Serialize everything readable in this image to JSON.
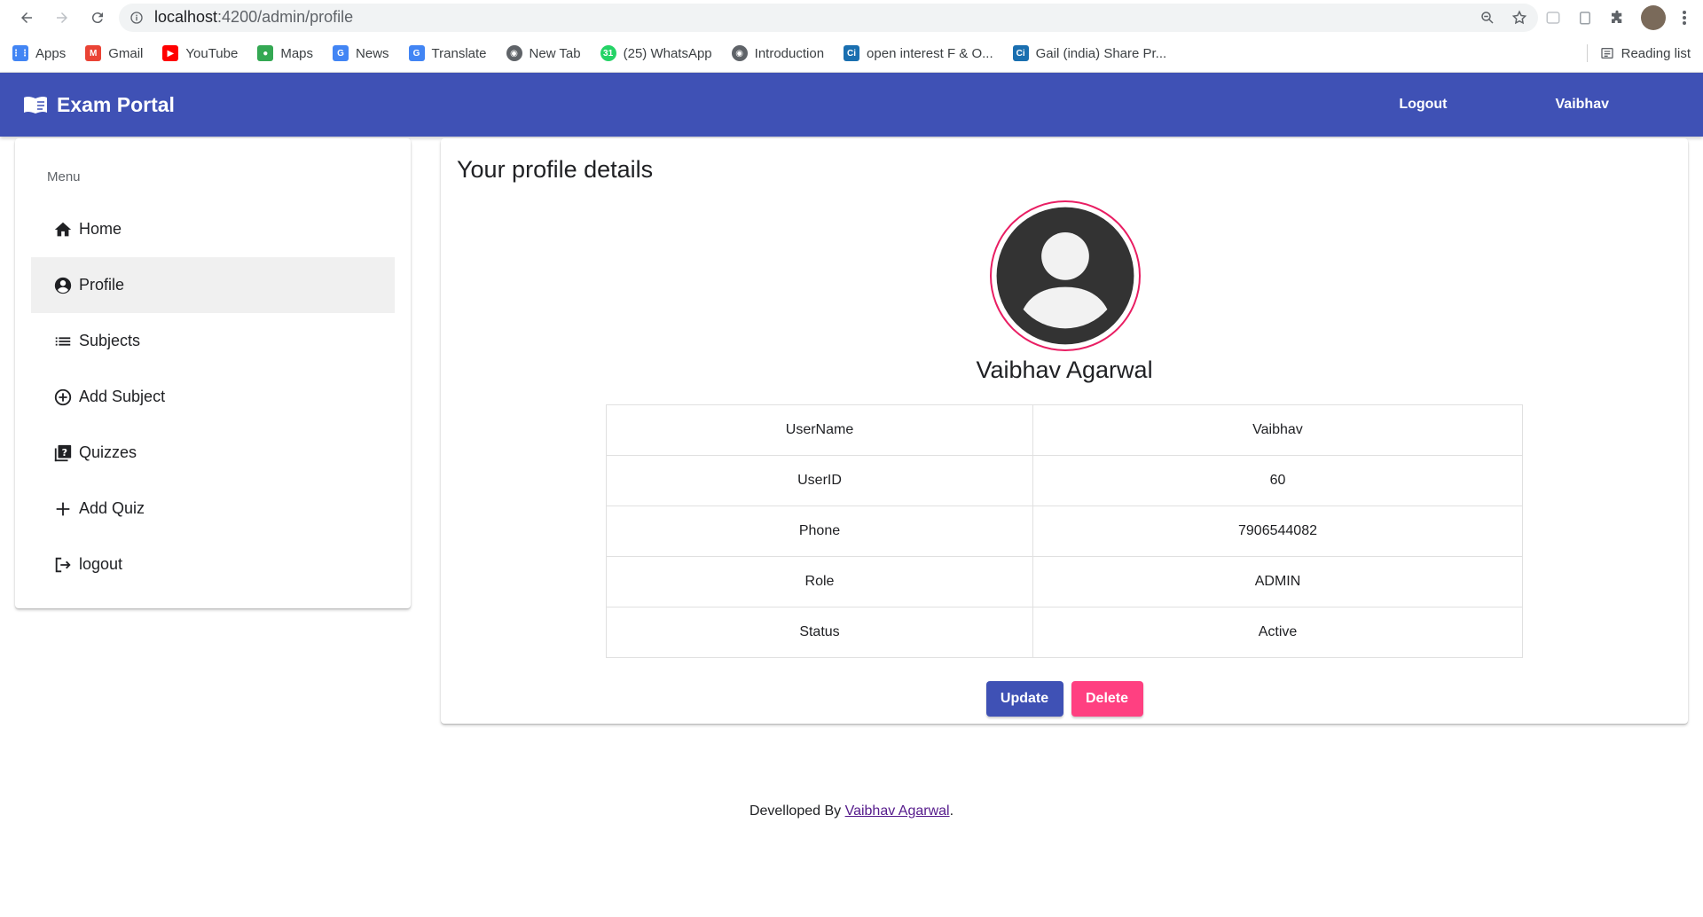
{
  "browser": {
    "url_host": "localhost",
    "url_path": ":4200/admin/profile",
    "bookmarks": [
      {
        "label": "Apps",
        "icon": "apps-grid-icon",
        "color": "#4285f4"
      },
      {
        "label": "Gmail",
        "icon": "gmail-icon",
        "color": "#ea4335"
      },
      {
        "label": "YouTube",
        "icon": "youtube-icon",
        "color": "#ff0000"
      },
      {
        "label": "Maps",
        "icon": "maps-icon",
        "color": "#34a853"
      },
      {
        "label": "News",
        "icon": "news-icon",
        "color": "#4285f4"
      },
      {
        "label": "Translate",
        "icon": "translate-icon",
        "color": "#4285f4"
      },
      {
        "label": "New Tab",
        "icon": "globe-icon",
        "color": "#5f6368"
      },
      {
        "label": "(25) WhatsApp",
        "icon": "whatsapp-icon",
        "color": "#25d366"
      },
      {
        "label": "Introduction",
        "icon": "globe-icon",
        "color": "#5f6368"
      },
      {
        "label": "open interest F & O...",
        "icon": "ci-icon",
        "color": "#1a6fb0"
      },
      {
        "label": "Gail (india) Share Pr...",
        "icon": "ci-icon",
        "color": "#1a6fb0"
      }
    ],
    "reading_list": "Reading list"
  },
  "navbar": {
    "brand": "Exam Portal",
    "logout": "Logout",
    "user": "Vaibhav",
    "color": "#3f51b5"
  },
  "sidebar": {
    "title": "Menu",
    "items": [
      {
        "label": "Home",
        "icon": "home-icon"
      },
      {
        "label": "Profile",
        "icon": "account-circle-icon",
        "active": true
      },
      {
        "label": "Subjects",
        "icon": "list-icon"
      },
      {
        "label": "Add Subject",
        "icon": "add-circle-icon"
      },
      {
        "label": "Quizzes",
        "icon": "quiz-icon"
      },
      {
        "label": "Add Quiz",
        "icon": "plus-icon"
      },
      {
        "label": "logout",
        "icon": "logout-icon"
      }
    ]
  },
  "profile": {
    "heading": "Your profile details",
    "name": "Vaibhav Agarwal",
    "rows": [
      {
        "key": "UserName",
        "value": "Vaibhav"
      },
      {
        "key": "UserID",
        "value": "60"
      },
      {
        "key": "Phone",
        "value": "7906544082"
      },
      {
        "key": "Role",
        "value": "ADMIN"
      },
      {
        "key": "Status",
        "value": "Active"
      }
    ],
    "update_label": "Update",
    "delete_label": "Delete"
  },
  "footer": {
    "prefix": "Develloped By ",
    "link": "Vaibhav Agarwal",
    "suffix": "."
  }
}
